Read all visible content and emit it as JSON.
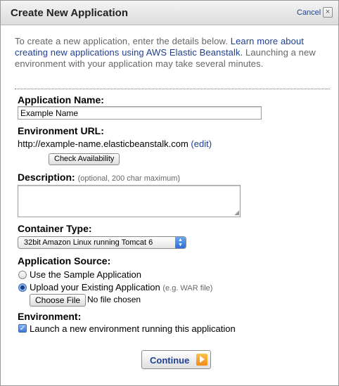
{
  "dialog": {
    "title": "Create New Application",
    "cancel_label": "Cancel",
    "close_glyph": "×"
  },
  "intro": {
    "text": "To create a new application, enter the details below. ",
    "link": "Learn more about creating new applications using AWS Elastic Beanstalk.",
    "text2": " Launching a new environment with your application may take several minutes."
  },
  "form": {
    "app_name_label": "Application Name:",
    "app_name_value": "Example Name",
    "env_url_label": "Environment URL:",
    "env_url_value": "http://example-name.elasticbeanstalk.com",
    "edit_link": "(edit)",
    "check_availability_label": "Check Availability",
    "description_label": "Description:",
    "description_hint": "(optional, 200 char maximum)",
    "description_value": "",
    "container_label": "Container Type:",
    "container_selected": "32bit Amazon Linux running Tomcat 6",
    "source_label": "Application Source:",
    "source_options": [
      {
        "label": "Use the Sample Application",
        "selected": false
      },
      {
        "label": "Upload your Existing Application",
        "hint": "(e.g. WAR file)",
        "selected": true
      }
    ],
    "choose_file_label": "Choose File",
    "no_file_text": "No file chosen",
    "environment_label": "Environment:",
    "launch_env_label": "Launch a new environment running this application",
    "launch_env_checked": true
  },
  "footer": {
    "continue_label": "Continue"
  },
  "colors": {
    "link": "#1f3f8f",
    "muted_text": "#666666",
    "accent_orange": "#ef8b16"
  },
  "icons": {
    "close": "close-icon",
    "select_arrows": "chevron-updown-icon",
    "continue_arrow": "arrow-right-icon",
    "check": "checkmark-icon",
    "resize_grip": "resize-grip-icon"
  }
}
